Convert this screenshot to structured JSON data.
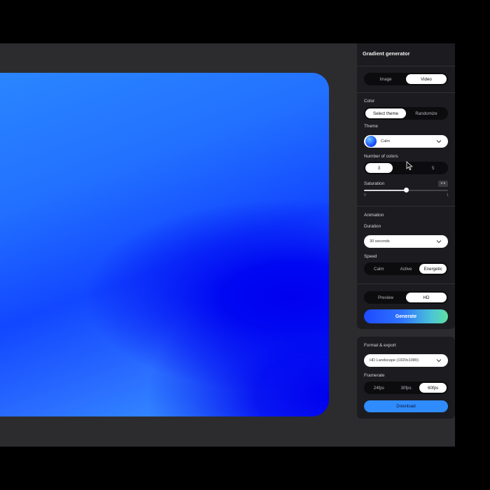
{
  "panel": {
    "title": "Gradient generator",
    "media_tabs": [
      {
        "label": "Image",
        "active": false
      },
      {
        "label": "Video",
        "active": true
      }
    ],
    "color_label": "Color",
    "color_tabs": [
      {
        "label": "Select theme",
        "active": true
      },
      {
        "label": "Randomize",
        "active": false
      }
    ],
    "theme_label": "Theme",
    "theme_value": "Calm",
    "num_colors_label": "Number of colors",
    "num_colors_options": [
      {
        "label": "3",
        "active": true
      },
      {
        "label": "",
        "active": false
      },
      {
        "label": "5",
        "active": false
      }
    ],
    "saturation_label": "Saturation",
    "saturation_value": "0.5",
    "saturation_fraction": 0.5,
    "saturation_min": "0",
    "saturation_max": "1",
    "animation_label": "Animation",
    "duration_label": "Duration",
    "duration_value": "30 seconds",
    "speed_label": "Speed",
    "speed_options": [
      {
        "label": "Calm",
        "active": false
      },
      {
        "label": "Active",
        "active": false
      },
      {
        "label": "Energetic",
        "active": true
      }
    ],
    "quality_tabs": [
      {
        "label": "Preview",
        "active": false
      },
      {
        "label": "HD",
        "active": true
      }
    ],
    "generate_label": "Generate"
  },
  "export": {
    "title": "Format & export",
    "format_value": "HD Landscape (1920x1080)",
    "framerate_label": "Framerate",
    "framerate_options": [
      {
        "label": "24fps",
        "active": false
      },
      {
        "label": "30fps",
        "active": false
      },
      {
        "label": "60fps",
        "active": true
      }
    ],
    "download_label": "Download"
  },
  "colors": {
    "accent": "#2f8cff",
    "panel_bg": "#1c1c20",
    "stage_bg": "#2c2c2e"
  }
}
